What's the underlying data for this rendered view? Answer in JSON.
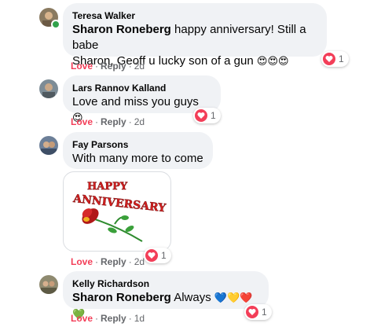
{
  "comments": [
    {
      "author": "Teresa Walker",
      "mention": "Sharon Roneberg",
      "text_line1": "happy anniversary! Still a babe",
      "text_line2": "Sharon, Geoff u lucky son of a gun",
      "emojis": "😍😍😍",
      "love_label": "Love",
      "reply_label": "Reply",
      "age": "2d",
      "reaction_count": "1",
      "online": true
    },
    {
      "author": "Lars Rannov Kalland",
      "text": "Love and miss you guys",
      "emojis": "😍",
      "love_label": "Love",
      "reply_label": "Reply",
      "age": "2d",
      "reaction_count": "1"
    },
    {
      "author": "Fay Parsons",
      "text": "With many more to come",
      "gif_text_1": "HAPPY",
      "gif_text_2": "ANNIVERSARY",
      "love_label": "Love",
      "reply_label": "Reply",
      "age": "2d",
      "reaction_count": "1"
    },
    {
      "author": "Kelly Richardson",
      "mention": "Sharon Roneberg",
      "text": "Always",
      "emojis": "💙💛❤️💚",
      "love_label": "Love",
      "reply_label": "Reply",
      "age": "1d",
      "reaction_count": "1"
    }
  ],
  "colors": {
    "bubble": "#f0f2f5",
    "love": "#f33e58",
    "meta": "#65676b",
    "online": "#31a24c"
  }
}
